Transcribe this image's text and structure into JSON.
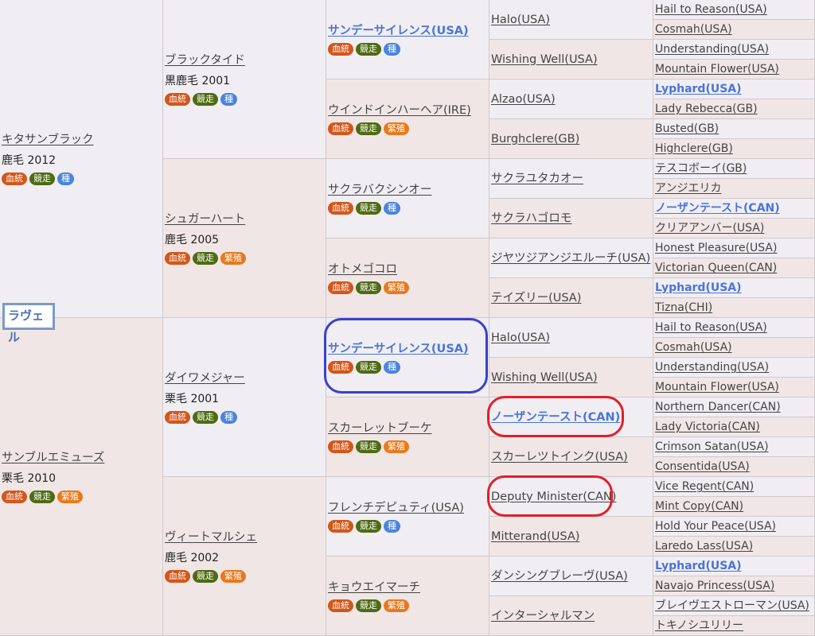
{
  "horse_name": "ラヴェル",
  "badge_labels": {
    "blood": "血統",
    "race": "競走",
    "stud": "種",
    "breed": "繁殖"
  },
  "gen1": [
    {
      "name": "キタサンブラック",
      "coat": "鹿毛 2012",
      "badges": [
        "blood",
        "race",
        "stud"
      ]
    },
    {
      "name": "サンブルエミューズ",
      "coat": "栗毛 2010",
      "badges": [
        "blood",
        "race",
        "breed"
      ]
    }
  ],
  "gen2": [
    {
      "name": "ブラックタイド",
      "coat": "黒鹿毛 2001",
      "badges": [
        "blood",
        "race",
        "stud"
      ]
    },
    {
      "name": "シュガーハート",
      "coat": "鹿毛 2005",
      "badges": [
        "blood",
        "race",
        "breed"
      ]
    },
    {
      "name": "ダイワメジャー",
      "coat": "栗毛 2001",
      "badges": [
        "blood",
        "race",
        "stud"
      ]
    },
    {
      "name": "ヴィートマルシェ",
      "coat": "鹿毛 2002",
      "badges": [
        "blood",
        "race",
        "breed"
      ]
    }
  ],
  "gen3": [
    {
      "name": "サンデーサイレンス(USA)",
      "highlight": true,
      "badges": [
        "blood",
        "race",
        "stud"
      ]
    },
    {
      "name": "ウインドインハーヘア(IRE)",
      "badges": [
        "blood",
        "race",
        "breed"
      ]
    },
    {
      "name": "サクラバクシンオー",
      "badges": [
        "blood",
        "race",
        "stud"
      ]
    },
    {
      "name": "オトメゴコロ",
      "badges": [
        "blood",
        "race",
        "breed"
      ]
    },
    {
      "name": "サンデーサイレンス(USA)",
      "highlight": true,
      "badges": [
        "blood",
        "race",
        "stud"
      ]
    },
    {
      "name": "スカーレットブーケ",
      "badges": [
        "blood",
        "race",
        "breed"
      ]
    },
    {
      "name": "フレンチデピュティ(USA)",
      "badges": [
        "blood",
        "race",
        "stud"
      ]
    },
    {
      "name": "キョウエイマーチ",
      "badges": [
        "blood",
        "race",
        "breed"
      ]
    }
  ],
  "gen4": [
    {
      "name": "Halo(USA)"
    },
    {
      "name": "Wishing Well(USA)"
    },
    {
      "name": "Alzao(USA)"
    },
    {
      "name": "Burghclere(GB)"
    },
    {
      "name": "サクラユタカオー"
    },
    {
      "name": "サクラハゴロモ"
    },
    {
      "name": "ジヤツジアンジエルーチ(USA)"
    },
    {
      "name": "テイズリー(USA)"
    },
    {
      "name": "Halo(USA)"
    },
    {
      "name": "Wishing Well(USA)"
    },
    {
      "name": "ノーザンテースト(CAN)",
      "highlight": true
    },
    {
      "name": "スカーレツトインク(USA)"
    },
    {
      "name": "Deputy Minister(CAN)"
    },
    {
      "name": "Mitterand(USA)"
    },
    {
      "name": "ダンシングブレーヴ(USA)"
    },
    {
      "name": "インターシャルマン"
    }
  ],
  "gen5": [
    {
      "name": "Hail to Reason(USA)"
    },
    {
      "name": "Cosmah(USA)"
    },
    {
      "name": "Understanding(USA)"
    },
    {
      "name": "Mountain Flower(USA)"
    },
    {
      "name": "Lyphard(USA)",
      "highlight": true
    },
    {
      "name": "Lady Rebecca(GB)"
    },
    {
      "name": "Busted(GB)"
    },
    {
      "name": "Highclere(GB)"
    },
    {
      "name": "テスコボーイ(GB)"
    },
    {
      "name": "アンジエリカ"
    },
    {
      "name": "ノーザンテースト(CAN)",
      "highlight": true
    },
    {
      "name": "クリアアンバー(USA)"
    },
    {
      "name": "Honest Pleasure(USA)"
    },
    {
      "name": "Victorian Queen(CAN)"
    },
    {
      "name": "Lyphard(USA)",
      "highlight": true
    },
    {
      "name": "Tizna(CHI)"
    },
    {
      "name": "Hail to Reason(USA)"
    },
    {
      "name": "Cosmah(USA)"
    },
    {
      "name": "Understanding(USA)"
    },
    {
      "name": "Mountain Flower(USA)"
    },
    {
      "name": "Northern Dancer(CAN)"
    },
    {
      "name": "Lady Victoria(CAN)"
    },
    {
      "name": "Crimson Satan(USA)"
    },
    {
      "name": "Consentida(USA)"
    },
    {
      "name": "Vice Regent(CAN)"
    },
    {
      "name": "Mint Copy(CAN)"
    },
    {
      "name": "Hold Your Peace(USA)"
    },
    {
      "name": "Laredo Lass(USA)"
    },
    {
      "name": "Lyphard(USA)",
      "highlight": true
    },
    {
      "name": "Navajo Princess(USA)"
    },
    {
      "name": "ブレイヴエストローマン(USA)"
    },
    {
      "name": "トキノシユリリー"
    }
  ],
  "colors": {
    "sire_bg": "#f0eef2",
    "dam_bg": "#f1e6e6",
    "link_highlight": "#4a74d8",
    "badge_blood": "#d3561a",
    "badge_race": "#4e6b12",
    "badge_stud": "#4a84dc",
    "badge_breed": "#e8791c",
    "ring_blue": "#3b3fcf",
    "ring_red": "#e0202a"
  }
}
